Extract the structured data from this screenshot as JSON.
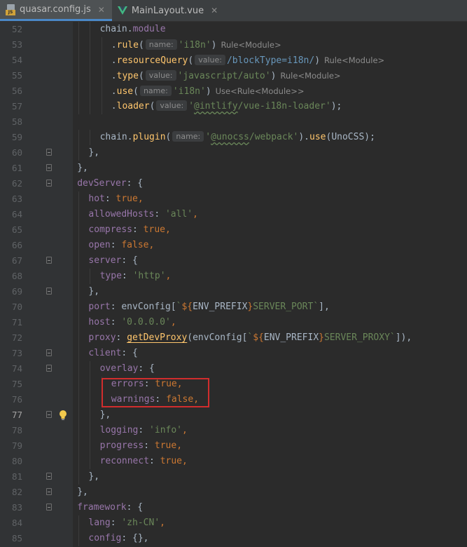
{
  "tabs": [
    {
      "label": "quasar.config.js",
      "icon": "js-file-icon",
      "active": true
    },
    {
      "label": "MainLayout.vue",
      "icon": "vue-file-icon",
      "active": false
    }
  ],
  "current_line": 77,
  "highlight": {
    "lines": [
      75,
      76
    ],
    "color": "#d12d2d"
  },
  "colors": {
    "keyword": "#cc7832",
    "string": "#6a8759",
    "property": "#9876aa",
    "function": "#ffc66d",
    "text": "#a9b7c6",
    "background": "#2b2b2b"
  },
  "lines": [
    {
      "n": 52,
      "indent": 3,
      "tokens": [
        [
          "p",
          "chain"
        ],
        [
          "t",
          "."
        ],
        [
          "pr",
          "module"
        ]
      ]
    },
    {
      "n": 53,
      "indent": 4,
      "tokens": [
        [
          "t",
          "."
        ],
        [
          "f",
          "rule"
        ],
        [
          "t",
          "("
        ],
        [
          "h",
          "name:"
        ],
        [
          "s",
          "'i18n'"
        ],
        [
          "t",
          ")"
        ],
        [
          "th",
          "Rule<Module>"
        ]
      ]
    },
    {
      "n": 54,
      "indent": 4,
      "tokens": [
        [
          "t",
          "."
        ],
        [
          "f",
          "resourceQuery"
        ],
        [
          "t",
          "("
        ],
        [
          "h",
          "value:"
        ],
        [
          "r",
          "/blockType=i18n/"
        ],
        [
          "t",
          ")"
        ],
        [
          "th",
          "Rule<Module>"
        ]
      ]
    },
    {
      "n": 55,
      "indent": 4,
      "tokens": [
        [
          "t",
          "."
        ],
        [
          "f",
          "type"
        ],
        [
          "t",
          "("
        ],
        [
          "h",
          "value:"
        ],
        [
          "s",
          "'javascript/auto'"
        ],
        [
          "t",
          ")"
        ],
        [
          "th",
          "Rule<Module>"
        ]
      ]
    },
    {
      "n": 56,
      "indent": 4,
      "tokens": [
        [
          "t",
          "."
        ],
        [
          "f",
          "use"
        ],
        [
          "t",
          "("
        ],
        [
          "h",
          "name:"
        ],
        [
          "s",
          "'i18n'"
        ],
        [
          "t",
          ")"
        ],
        [
          "th",
          "Use<Rule<Module>>"
        ]
      ]
    },
    {
      "n": 57,
      "indent": 4,
      "tokens": [
        [
          "t",
          "."
        ],
        [
          "f",
          "loader"
        ],
        [
          "t",
          "("
        ],
        [
          "h",
          "value:"
        ],
        [
          "s",
          "'"
        ],
        [
          "sq",
          "@intlify"
        ],
        [
          "s",
          "/vue-i18n-loader'"
        ],
        [
          "t",
          ");"
        ]
      ]
    },
    {
      "n": 58,
      "indent": 0,
      "tokens": []
    },
    {
      "n": 59,
      "indent": 3,
      "tokens": [
        [
          "p",
          "chain"
        ],
        [
          "t",
          "."
        ],
        [
          "f",
          "plugin"
        ],
        [
          "t",
          "("
        ],
        [
          "h",
          "name:"
        ],
        [
          "s",
          "'"
        ],
        [
          "sq",
          "@unocss"
        ],
        [
          "s",
          "/webpack'"
        ],
        [
          "t",
          ")."
        ],
        [
          "f",
          "use"
        ],
        [
          "t",
          "("
        ],
        [
          "p",
          "UnoCSS"
        ],
        [
          "t",
          ");"
        ]
      ]
    },
    {
      "n": 60,
      "indent": 2,
      "fold": true,
      "tokens": [
        [
          "t",
          "},"
        ]
      ]
    },
    {
      "n": 61,
      "indent": 1,
      "fold": true,
      "tokens": [
        [
          "t",
          "},"
        ]
      ]
    },
    {
      "n": 62,
      "indent": 1,
      "fold": true,
      "tokens": [
        [
          "pr",
          "devServer"
        ],
        [
          "t",
          ": {"
        ]
      ]
    },
    {
      "n": 63,
      "indent": 2,
      "tokens": [
        [
          "pr",
          "hot"
        ],
        [
          "t",
          ": "
        ],
        [
          "k",
          "true"
        ],
        [
          "k",
          ","
        ]
      ]
    },
    {
      "n": 64,
      "indent": 2,
      "tokens": [
        [
          "pr",
          "allowedHosts"
        ],
        [
          "t",
          ": "
        ],
        [
          "s",
          "'all'"
        ],
        [
          "k",
          ","
        ]
      ]
    },
    {
      "n": 65,
      "indent": 2,
      "tokens": [
        [
          "pr",
          "compress"
        ],
        [
          "t",
          ": "
        ],
        [
          "k",
          "true"
        ],
        [
          "k",
          ","
        ]
      ]
    },
    {
      "n": 66,
      "indent": 2,
      "tokens": [
        [
          "pr",
          "open"
        ],
        [
          "t",
          ": "
        ],
        [
          "k",
          "false"
        ],
        [
          "k",
          ","
        ]
      ]
    },
    {
      "n": 67,
      "indent": 2,
      "fold": true,
      "tokens": [
        [
          "pr",
          "server"
        ],
        [
          "t",
          ": {"
        ]
      ]
    },
    {
      "n": 68,
      "indent": 3,
      "tokens": [
        [
          "pr",
          "type"
        ],
        [
          "t",
          ": "
        ],
        [
          "s",
          "'http'"
        ],
        [
          "k",
          ","
        ]
      ]
    },
    {
      "n": 69,
      "indent": 2,
      "fold": true,
      "tokens": [
        [
          "t",
          "},"
        ]
      ]
    },
    {
      "n": 70,
      "indent": 2,
      "tokens": [
        [
          "pr",
          "port"
        ],
        [
          "t",
          ": "
        ],
        [
          "p",
          "envConfig"
        ],
        [
          "t",
          "["
        ],
        [
          "s",
          "`"
        ],
        [
          "k",
          "${"
        ],
        [
          "p",
          "ENV_PREFIX"
        ],
        [
          "k",
          "}"
        ],
        [
          "s",
          "SERVER_PORT`"
        ],
        [
          "t",
          "],"
        ]
      ]
    },
    {
      "n": 71,
      "indent": 2,
      "tokens": [
        [
          "pr",
          "host"
        ],
        [
          "t",
          ": "
        ],
        [
          "s",
          "'0.0.0.0'"
        ],
        [
          "k",
          ","
        ]
      ]
    },
    {
      "n": 72,
      "indent": 2,
      "tokens": [
        [
          "pr",
          "proxy"
        ],
        [
          "t",
          ": "
        ],
        [
          "fu",
          "getDevProxy"
        ],
        [
          "t",
          "("
        ],
        [
          "p",
          "envConfig"
        ],
        [
          "t",
          "["
        ],
        [
          "s",
          "`"
        ],
        [
          "k",
          "${"
        ],
        [
          "p",
          "ENV_PREFIX"
        ],
        [
          "k",
          "}"
        ],
        [
          "s",
          "SERVER_PROXY`"
        ],
        [
          "t",
          "]),"
        ]
      ]
    },
    {
      "n": 73,
      "indent": 2,
      "fold": true,
      "tokens": [
        [
          "pr",
          "client"
        ],
        [
          "t",
          ": {"
        ]
      ]
    },
    {
      "n": 74,
      "indent": 3,
      "fold": true,
      "tokens": [
        [
          "pr",
          "overlay"
        ],
        [
          "t",
          ": {"
        ]
      ]
    },
    {
      "n": 75,
      "indent": 4,
      "tokens": [
        [
          "pr",
          "errors"
        ],
        [
          "t",
          ": "
        ],
        [
          "k",
          "true"
        ],
        [
          "k",
          ","
        ]
      ]
    },
    {
      "n": 76,
      "indent": 4,
      "tokens": [
        [
          "pr",
          "warnings"
        ],
        [
          "t",
          ": "
        ],
        [
          "k",
          "false"
        ],
        [
          "k",
          ","
        ]
      ]
    },
    {
      "n": 77,
      "indent": 3,
      "fold": true,
      "bulb": true,
      "tokens": [
        [
          "t",
          "},"
        ]
      ]
    },
    {
      "n": 78,
      "indent": 3,
      "tokens": [
        [
          "pr",
          "logging"
        ],
        [
          "t",
          ": "
        ],
        [
          "s",
          "'info'"
        ],
        [
          "k",
          ","
        ]
      ]
    },
    {
      "n": 79,
      "indent": 3,
      "tokens": [
        [
          "pr",
          "progress"
        ],
        [
          "t",
          ": "
        ],
        [
          "k",
          "true"
        ],
        [
          "k",
          ","
        ]
      ]
    },
    {
      "n": 80,
      "indent": 3,
      "tokens": [
        [
          "pr",
          "reconnect"
        ],
        [
          "t",
          ": "
        ],
        [
          "k",
          "true"
        ],
        [
          "k",
          ","
        ]
      ]
    },
    {
      "n": 81,
      "indent": 2,
      "fold": true,
      "tokens": [
        [
          "t",
          "},"
        ]
      ]
    },
    {
      "n": 82,
      "indent": 1,
      "fold": true,
      "tokens": [
        [
          "t",
          "},"
        ]
      ]
    },
    {
      "n": 83,
      "indent": 1,
      "fold": true,
      "tokens": [
        [
          "pr",
          "framework"
        ],
        [
          "t",
          ": {"
        ]
      ]
    },
    {
      "n": 84,
      "indent": 2,
      "tokens": [
        [
          "pr",
          "lang"
        ],
        [
          "t",
          ": "
        ],
        [
          "s",
          "'zh-CN'"
        ],
        [
          "k",
          ","
        ]
      ]
    },
    {
      "n": 85,
      "indent": 2,
      "tokens": [
        [
          "pr",
          "config"
        ],
        [
          "t",
          ": {},"
        ]
      ]
    }
  ]
}
